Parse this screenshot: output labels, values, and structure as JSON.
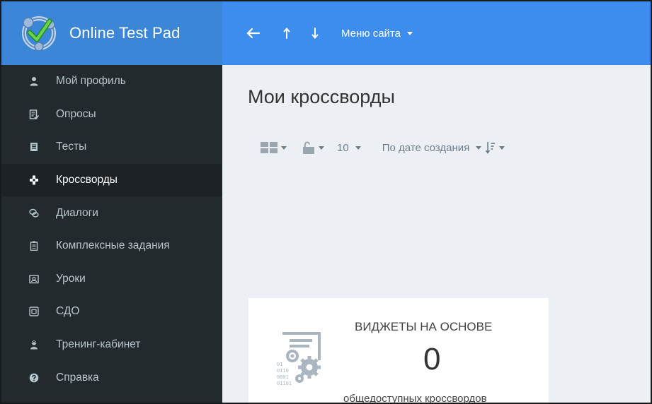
{
  "header": {
    "brand": "Online Test Pad",
    "site_menu": "Меню сайта"
  },
  "sidebar": {
    "items": [
      {
        "label": "Мой профиль",
        "icon": "user-icon",
        "active": false
      },
      {
        "label": "Опросы",
        "icon": "survey-icon",
        "active": false
      },
      {
        "label": "Тесты",
        "icon": "test-icon",
        "active": false
      },
      {
        "label": "Кроссворды",
        "icon": "crossword-icon",
        "active": true
      },
      {
        "label": "Диалоги",
        "icon": "dialog-icon",
        "active": false
      },
      {
        "label": "Комплексные задания",
        "icon": "clipboard-icon",
        "active": false
      },
      {
        "label": "Уроки",
        "icon": "lesson-icon",
        "active": false
      },
      {
        "label": "СДО",
        "icon": "lms-icon",
        "active": false
      },
      {
        "label": "Тренинг-кабинет",
        "icon": "training-icon",
        "active": false
      },
      {
        "label": "Справка",
        "icon": "help-icon",
        "active": false
      }
    ]
  },
  "main": {
    "title": "Мои кроссворды",
    "toolbar": {
      "page_size": "10",
      "sort": "По дате создания"
    },
    "widget": {
      "title": "ВИДЖЕТЫ НА ОСНОВЕ",
      "count": "0",
      "subtitle": "общедоступных кроссвордов"
    }
  },
  "colors": {
    "header_brand_bg": "#3b86d6",
    "header_bg": "#3c8dee",
    "sidebar_bg": "#232a2e",
    "sidebar_active_bg": "#1c2226",
    "content_bg": "#ecf0f5"
  }
}
